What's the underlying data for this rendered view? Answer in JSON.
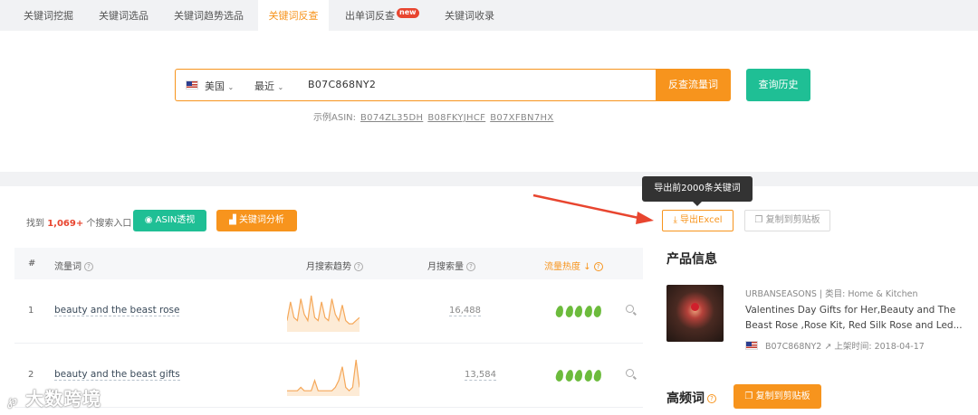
{
  "tabs": [
    {
      "label": "关键词挖掘"
    },
    {
      "label": "关键词选品"
    },
    {
      "label": "关键词趋势选品"
    },
    {
      "label": "关键词反查"
    },
    {
      "label": "出单词反查"
    },
    {
      "label": "关键词收录"
    }
  ],
  "new_badge": "new",
  "search": {
    "country": "美国",
    "period": "最近",
    "asin_value": "B07C868NY2",
    "submit_label": "反查流量词",
    "history_label": "查询历史",
    "examples_label": "示例ASIN:",
    "examples": [
      "B074ZL35DH",
      "B08FKYJHCF",
      "B07XFBN7HX"
    ]
  },
  "results": {
    "found_prefix": "找到",
    "found_count": "1,069+",
    "found_suffix": "个搜索入口",
    "asin_view_label": "ASIN透视",
    "keyword_analysis_label": "关键词分析",
    "export_label": "导出Excel",
    "export_tooltip": "导出前2000条关键词",
    "copy_label": "复制到剪贴板",
    "columns": {
      "index": "#",
      "keyword": "流量词",
      "trend": "月搜索趋势",
      "volume": "月搜索量",
      "heat": "流量热度"
    },
    "rows": [
      {
        "index": "1",
        "keyword": "beauty and the beast rose",
        "volume": "16,488",
        "heat": 5,
        "trend": [
          3,
          9,
          4,
          3,
          10,
          5,
          3,
          11,
          4,
          3,
          9,
          4,
          3,
          10,
          5,
          3,
          8,
          3,
          2,
          2,
          3,
          4
        ]
      },
      {
        "index": "2",
        "keyword": "beauty and the beast gifts",
        "volume": "13,584",
        "heat": 5,
        "trend": [
          1,
          1,
          1,
          1,
          2,
          1,
          1,
          1,
          4,
          1,
          1,
          1,
          1,
          1,
          2,
          4,
          8,
          2,
          1,
          2,
          10,
          2
        ]
      }
    ]
  },
  "product": {
    "section_title": "产品信息",
    "brand": "URBANSEASONS",
    "category_label": "类目: Home & Kitchen",
    "title": "Valentines Day Gifts for Her,Beauty and The Beast Rose ,Rose Kit, Red Silk Rose and Led...",
    "asin": "B07C868NY2",
    "listed_label": "上架时间: 2018-04-17"
  },
  "high_freq": {
    "title": "高频词",
    "copy_label": "复制到剪贴板"
  },
  "watermark": "大数跨境",
  "colors": {
    "accent": "#f7941d",
    "teal": "#1fbf95",
    "arrow": "#e8452f"
  }
}
